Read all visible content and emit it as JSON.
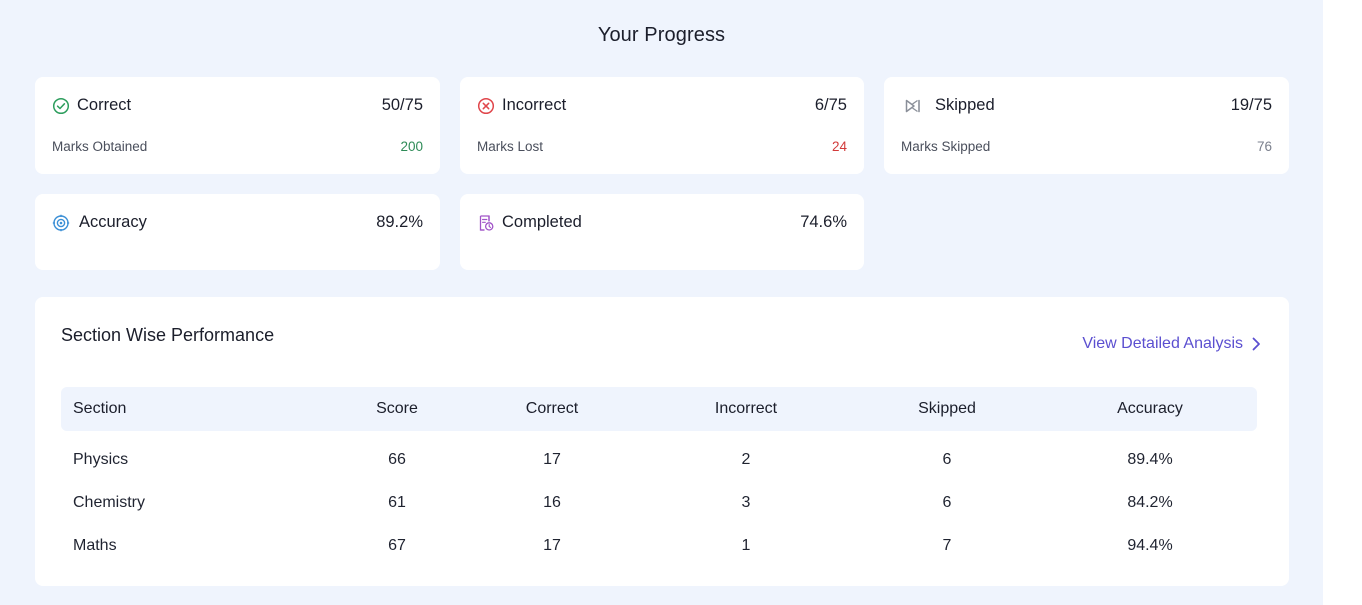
{
  "page_title": "Your Progress",
  "cards": [
    {
      "id": "correct",
      "icon": "check-circle-icon",
      "title": "Correct",
      "value": "50/75",
      "sub_label": "Marks Obtained",
      "sub_value": "200",
      "sub_color": "#2e8b57",
      "icon_color": "#2e9e5e"
    },
    {
      "id": "incorrect",
      "icon": "x-circle-icon",
      "title": "Incorrect",
      "value": "6/75",
      "sub_label": "Marks Lost",
      "sub_value": "24",
      "sub_color": "#d23a3a",
      "icon_color": "#e0464b"
    },
    {
      "id": "skipped",
      "icon": "skip-icon",
      "title": "Skipped",
      "value": "19/75",
      "sub_label": "Marks Skipped",
      "sub_value": "76",
      "sub_color": "#7a7f8c",
      "icon_color": "#8a8f99"
    },
    {
      "id": "accuracy",
      "icon": "target-icon",
      "title": "Accuracy",
      "value": "89.2%",
      "icon_color": "#3b8fd6"
    },
    {
      "id": "completed",
      "icon": "document-clock-icon",
      "title": "Completed",
      "value": "74.6%",
      "icon_color": "#a154c8"
    }
  ],
  "section_perf": {
    "title": "Section Wise Performance",
    "link_label": "View Detailed Analysis",
    "link_color": "#5b4fd0",
    "columns": [
      "Section",
      "Score",
      "Correct",
      "Incorrect",
      "Skipped",
      "Accuracy"
    ],
    "rows": [
      [
        "Physics",
        "66",
        "17",
        "2",
        "6",
        "89.4%"
      ],
      [
        "Chemistry",
        "61",
        "16",
        "3",
        "6",
        "84.2%"
      ],
      [
        "Maths",
        "67",
        "17",
        "1",
        "7",
        "94.4%"
      ]
    ]
  }
}
